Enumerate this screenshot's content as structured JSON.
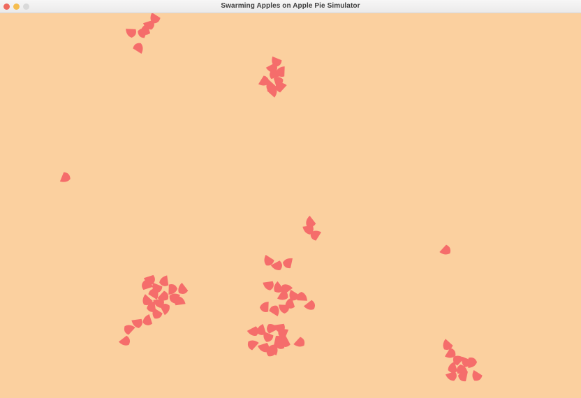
{
  "window": {
    "title": "Swarming Apples on Apple Pie Simulator"
  },
  "colors": {
    "background": "#fbd09f",
    "apple": "#f56d6b"
  },
  "icons": [
    "close-icon",
    "minimize-icon",
    "zoom-icon"
  ]
}
